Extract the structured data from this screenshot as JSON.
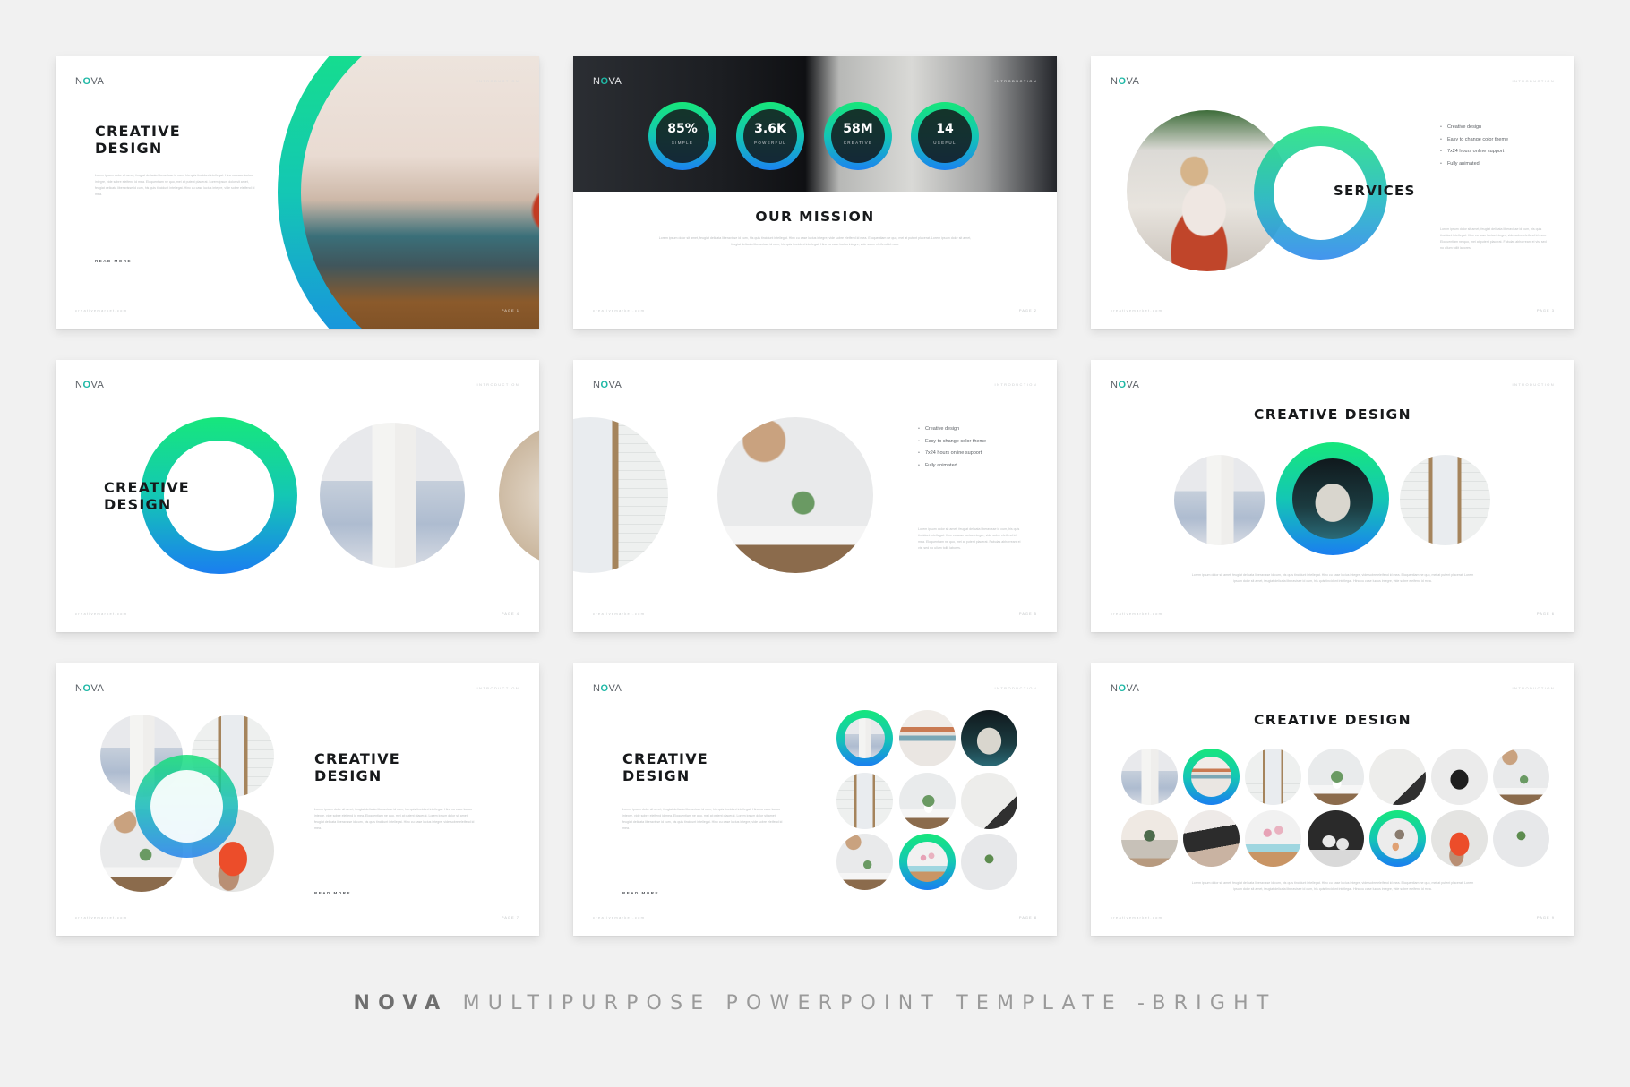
{
  "brand": {
    "logo_n": "N",
    "logo_o": "O",
    "logo_va": "VA",
    "section_label": "INTRODUCTION",
    "footer_site": "creativemarket.com",
    "accent_green": "#16e77c",
    "accent_teal": "#14c7b4",
    "accent_blue": "#1a7ef0"
  },
  "lorem_short": "Lorem ipsum dolor sit amet, feugiat delicata liberavisse id cum, his quis tincidunt intellegat. Hinc cu case lucius integre, vide sobre eleifend id mea. Eloquentiam ne quo, mei at putent placerat. Fabulas abhorreant ei vis, sed no ullum tollit labores.",
  "lorem_long": "Lorem ipsum dolor sit amet, feugiat delicata liberavisse id cum, his quis tincidunt intellegat. Hinc cu case lucius integre, vide sobre eleifend id mea. Eloquentiam ne quo, mei at putent placerat. Lorem ipsum dolor sit amet, feugiat delicata liberavisse id cum, his quis tincidunt intellegat. Hinc cu case lucius integre, vide sobre eleifend id mea.",
  "slides": [
    {
      "title_line1": "CREATIVE",
      "title_line2": "DESIGN",
      "read_more": "READ MORE",
      "page": "PAGE 1"
    },
    {
      "title": "OUR MISSION",
      "page": "PAGE 2",
      "stats": [
        {
          "value": "85%",
          "label": "SIMPLE"
        },
        {
          "value": "3.6K",
          "label": "POWERFUL"
        },
        {
          "value": "58M",
          "label": "CREATIVE"
        },
        {
          "value": "14",
          "label": "USEFUL"
        }
      ]
    },
    {
      "title": "SERVICES",
      "page": "PAGE 3",
      "bullets": [
        "Creative design",
        "Easy to change color theme",
        "7x24 hours online support",
        "Fully animated"
      ]
    },
    {
      "title_line1": "CREATIVE",
      "title_line2": "DESIGN",
      "page": "PAGE 4"
    },
    {
      "page": "PAGE 5",
      "bullets": [
        "Creative design",
        "Easy to change color theme",
        "7x24 hours online support",
        "Fully animated"
      ]
    },
    {
      "title": "CREATIVE DESIGN",
      "page": "PAGE 6"
    },
    {
      "title_line1": "CREATIVE",
      "title_line2": "DESIGN",
      "read_more": "READ MORE",
      "page": "PAGE 7"
    },
    {
      "title_line1": "CREATIVE",
      "title_line2": "DESIGN",
      "read_more": "READ MORE",
      "page": "PAGE 8"
    },
    {
      "title": "CREATIVE DESIGN",
      "page": "PAGE 9"
    }
  ],
  "caption": {
    "brand": "NOVA",
    "rest": "MULTIPURPOSE POWERPOINT TEMPLATE -BRIGHT"
  }
}
